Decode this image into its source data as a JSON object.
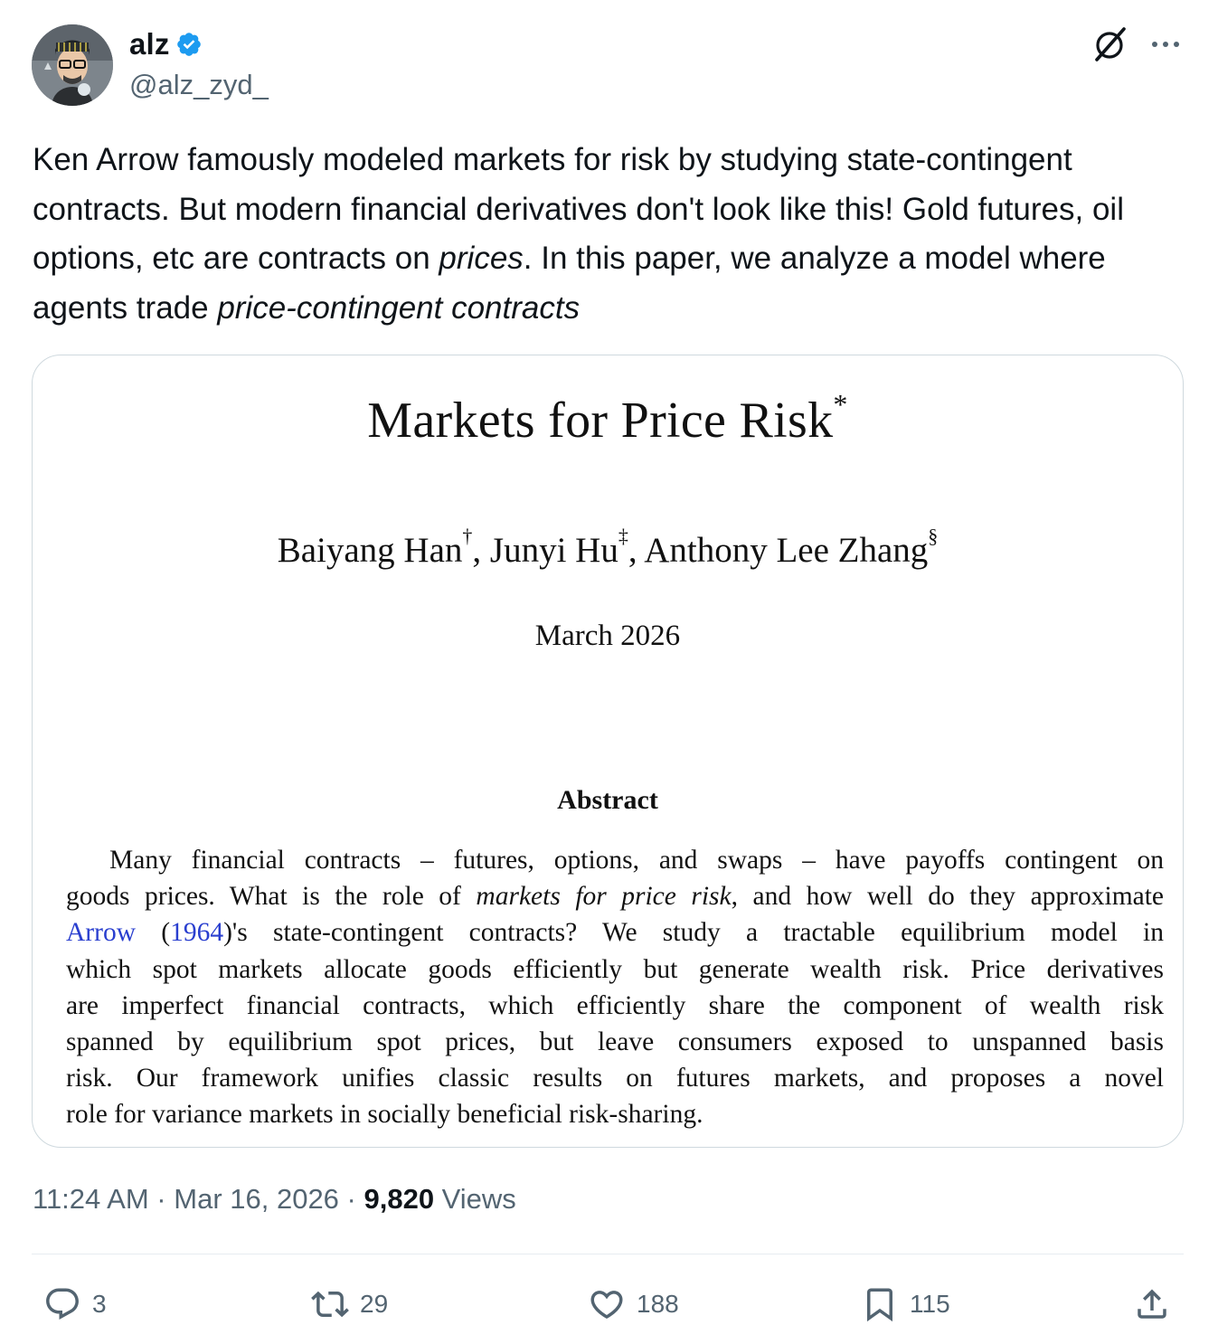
{
  "author": {
    "display_name": "alz",
    "handle": "@alz_zyd_",
    "verified": true
  },
  "tweet": {
    "text_1": "Ken Arrow famously modeled markets for risk by studying state-contingent contracts. But modern financial derivatives don't look like this! Gold futures, oil options, etc are contracts on ",
    "emphasis_1": "prices",
    "text_2": ". In this paper, we analyze a model where agents trade ",
    "emphasis_2": "price-contingent contracts"
  },
  "paper": {
    "title": "Markets for Price Risk",
    "title_mark": "*",
    "author_1": "Baiyang Han",
    "author_1_mark": "†",
    "author_2": "Junyi Hu",
    "author_2_mark": "‡",
    "author_3": "Anthony Lee Zhang",
    "author_3_mark": "§",
    "date": "March 2026",
    "abstract_heading": "Abstract",
    "abstract_lines": {
      "l1": "Many financial contracts – futures, options, and swaps – have payoffs contingent on",
      "l2a": "goods prices. What is the role of ",
      "l2b": "markets for price risk",
      "l2c": ", and how well do they approximate",
      "l3a": "Arrow",
      "l3b": " (",
      "l3c": "1964",
      "l3d": ")'s state-contingent contracts? We study a tractable equilibrium model in",
      "l4": "which spot markets allocate goods efficiently but generate wealth risk. Price derivatives",
      "l5": "are imperfect financial contracts, which efficiently share the component of wealth risk",
      "l6": "spanned by equilibrium spot prices, but leave consumers exposed to unspanned basis",
      "l7": "risk. Our framework unifies classic results on futures markets, and proposes a novel",
      "l8": "role for variance markets in socially beneficial risk-sharing."
    }
  },
  "meta": {
    "time": "11:24 AM",
    "separator": " · ",
    "date": "Mar 16, 2026",
    "views_count": "9,820",
    "views_label": " Views"
  },
  "actions": {
    "replies": "3",
    "reposts": "29",
    "likes": "188",
    "bookmarks": "115"
  },
  "colors": {
    "verified_badge": "#1d9bf0",
    "secondary_text": "#536471",
    "citation_link": "#2a3fcf",
    "border": "#cfd9de"
  },
  "icons": [
    "grok-icon",
    "more-icon",
    "reply-icon",
    "repost-icon",
    "like-icon",
    "bookmark-icon",
    "share-icon",
    "verified-badge-icon"
  ]
}
